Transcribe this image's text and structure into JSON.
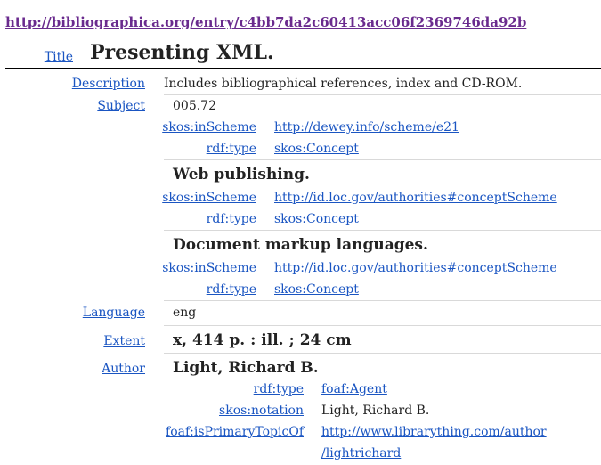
{
  "entry_url": "http://bibliographica.org/entry/c4bb7da2c60413acc06f2369746da92b",
  "title": {
    "label": "Title",
    "value": "Presenting XML."
  },
  "description": {
    "label": "Description",
    "value": "Includes bibliographical references, index and CD-ROM."
  },
  "subject": {
    "label": "Subject",
    "items": [
      {
        "name": "005.72",
        "scheme_pred": "skos:inScheme",
        "scheme_obj": "http://dewey.info/scheme/e21",
        "type_pred": "rdf:type",
        "type_obj": "skos:Concept"
      },
      {
        "name": "Web publishing.",
        "scheme_pred": "skos:inScheme",
        "scheme_obj": "http://id.loc.gov/authorities#conceptScheme",
        "type_pred": "rdf:type",
        "type_obj": "skos:Concept"
      },
      {
        "name": "Document markup languages.",
        "scheme_pred": "skos:inScheme",
        "scheme_obj": "http://id.loc.gov/authorities#conceptScheme",
        "type_pred": "rdf:type",
        "type_obj": "skos:Concept"
      }
    ]
  },
  "language": {
    "label": "Language",
    "value": "eng"
  },
  "extent": {
    "label": "Extent",
    "value": "x, 414 p. : ill. ; 24 cm"
  },
  "author": {
    "label": "Author",
    "name": "Light, Richard B.",
    "type_pred": "rdf:type",
    "type_obj": "foaf:Agent",
    "notation_pred": "skos:notation",
    "notation_obj": "Light, Richard B.",
    "topic_pred": "foaf:isPrimaryTopicOf",
    "topic_obj_line1": "http://www.librarything.com/author",
    "topic_obj_line2": "/lightrichard"
  }
}
